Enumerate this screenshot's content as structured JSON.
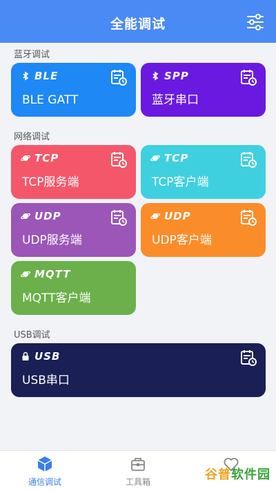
{
  "header": {
    "title": "全能调试"
  },
  "sections": {
    "bluetooth": "蓝牙调试",
    "network": "网络调试",
    "usb": "USB调试"
  },
  "cards": {
    "ble": {
      "tag": "BLE",
      "label": "BLE GATT",
      "color": "#1e88f5"
    },
    "spp": {
      "tag": "SPP",
      "label": "蓝牙串口",
      "color": "#6a1ae0"
    },
    "tcp_server": {
      "tag": "TCP",
      "label": "TCP服务端",
      "color": "#f4576a"
    },
    "tcp_client": {
      "tag": "TCP",
      "label": "TCP客户端",
      "color": "#3fd0e0"
    },
    "udp_server": {
      "tag": "UDP",
      "label": "UDP服务端",
      "color": "#9b56b8"
    },
    "udp_client": {
      "tag": "UDP",
      "label": "UDP客户端",
      "color": "#fb8c2a"
    },
    "mqtt": {
      "tag": "MQTT",
      "label": "MQTT客户端",
      "color": "#6bb04a"
    },
    "usb": {
      "tag": "USB",
      "label": "USB串口",
      "color": "#1a1f55"
    }
  },
  "tabbar": {
    "tabs": [
      {
        "label": "通信调试",
        "icon": "cube-icon",
        "active": true
      },
      {
        "label": "工具箱",
        "icon": "toolbox-icon",
        "active": false
      },
      {
        "label": "",
        "icon": "heart-icon",
        "active": false
      }
    ],
    "active_color": "#3a7ef0",
    "inactive_color": "#888888"
  },
  "watermark": {
    "text": "谷普软件园"
  }
}
